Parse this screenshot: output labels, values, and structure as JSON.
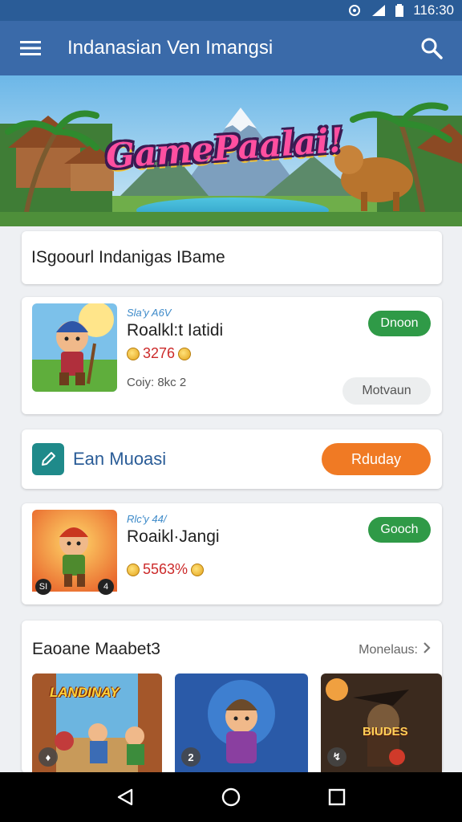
{
  "status_bar": {
    "time": "116:30",
    "icons": [
      "vibrate-icon",
      "signal-icon",
      "battery-icon"
    ]
  },
  "app_bar": {
    "title": "Indanasian Ven Imangsi",
    "menu_icon": "hamburger-menu-icon",
    "search_icon": "search-icon"
  },
  "banner": {
    "logo_text": "GamePaalai!"
  },
  "section": {
    "title": "ISgoourl Indanigas IBame"
  },
  "games": [
    {
      "tag": "Sla'y A6V",
      "name": "Roalkl:t Iatidi",
      "score": "3276",
      "meta": "Coiy: 8kc 2",
      "primary_label": "Dnoon",
      "secondary_label": "Motvaun",
      "primary_color": "#2f9a47"
    },
    {
      "tag": "Rlc'y 44/",
      "name": "Roaikl·Jangi",
      "score": "5563%",
      "primary_label": "Gooch",
      "primary_color": "#2f9a47",
      "thumb_badges": [
        "SI",
        "4"
      ]
    }
  ],
  "promo": {
    "text": "Ean Muoasi",
    "button_label": "Rduday",
    "button_color": "#f07a24",
    "icon": "edit-icon"
  },
  "more_section": {
    "title": "Eaoane Maabet3",
    "link_label": "Monelaus:",
    "tiles": [
      {
        "banner_text": "LANDINAY",
        "badge": "♦"
      },
      {
        "banner_text": "",
        "badge": "2"
      },
      {
        "banner_text": "BIUDES",
        "badge": "↯"
      }
    ]
  },
  "nav_bar": {
    "back_icon": "back-triangle-icon",
    "home_icon": "home-circle-icon",
    "recents_icon": "recents-square-icon"
  }
}
